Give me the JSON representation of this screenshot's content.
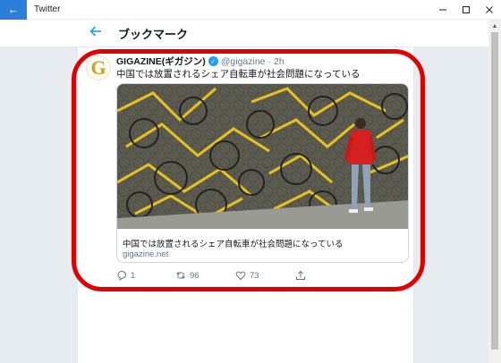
{
  "window": {
    "title": "Twitter"
  },
  "header": {
    "title": "ブックマーク"
  },
  "tweet": {
    "display_name": "GIGAZINE(ギガジン)",
    "handle": "@gigazine",
    "separator": "·",
    "time": "2h",
    "text": "中国では放置されるシェア自転車が社会問題になっている",
    "avatar_letter": "G",
    "card": {
      "title": "中国では放置されるシェア自転車が社会問題になっている",
      "domain": "gigazine.net"
    },
    "actions": {
      "reply_count": "1",
      "retweet_count": "96",
      "like_count": "73"
    }
  },
  "colors": {
    "accent": "#1da1f2",
    "titlebar_back": "#2b7fd9",
    "highlight": "#e10000",
    "bike_yellow": "#e8c21c"
  },
  "icons": {
    "window_back": "back-arrow-icon",
    "header_back": "back-arrow-icon",
    "verified": "verified-check-icon",
    "reply": "reply-icon",
    "retweet": "retweet-icon",
    "like": "heart-icon",
    "share": "share-icon"
  }
}
